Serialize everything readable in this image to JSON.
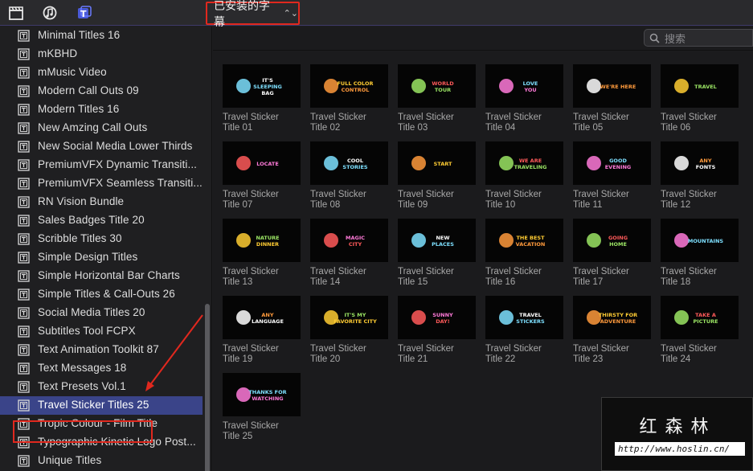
{
  "toolbar": {
    "library_title": "已安装的字幕"
  },
  "sidebar": {
    "items": [
      {
        "label": "Minimal Titles 16"
      },
      {
        "label": "mKBHD"
      },
      {
        "label": "mMusic Video"
      },
      {
        "label": "Modern Call Outs 09"
      },
      {
        "label": "Modern Titles 16"
      },
      {
        "label": "New Amzing Call Outs"
      },
      {
        "label": "New Social Media Lower Thirds"
      },
      {
        "label": "PremiumVFX Dynamic Transiti..."
      },
      {
        "label": "PremiumVFX Seamless Transiti..."
      },
      {
        "label": "RN Vision Bundle"
      },
      {
        "label": "Sales Badges Title 20"
      },
      {
        "label": "Scribble Titles 30"
      },
      {
        "label": "Simple Design Titles"
      },
      {
        "label": "Simple Horizontal Bar Charts"
      },
      {
        "label": "Simple Titles & Call-Outs 26"
      },
      {
        "label": "Social Media Titles 20"
      },
      {
        "label": "Subtitles Tool FCPX"
      },
      {
        "label": "Text Animation Toolkit 87"
      },
      {
        "label": "Text Messages 18"
      },
      {
        "label": "Text Presets Vol.1"
      },
      {
        "label": "Travel Sticker Titles 25",
        "selected": true
      },
      {
        "label": "Tropic Colour - Film Title"
      },
      {
        "label": "Typographic Kinetic Logo Post..."
      },
      {
        "label": "Unique Titles"
      }
    ]
  },
  "search": {
    "placeholder": "搜索"
  },
  "tiles": [
    {
      "line1": "Travel Sticker",
      "line2": "Title 01",
      "art": [
        "IT'S",
        "SLEEPING",
        "BAG"
      ]
    },
    {
      "line1": "Travel Sticker",
      "line2": "Title 02",
      "art": [
        "FULL COLOR",
        "CONTROL"
      ]
    },
    {
      "line1": "Travel Sticker",
      "line2": "Title 03",
      "art": [
        "WORLD",
        "TOUR"
      ]
    },
    {
      "line1": "Travel Sticker",
      "line2": "Title 04",
      "art": [
        "LOVE",
        "YOU"
      ]
    },
    {
      "line1": "Travel Sticker",
      "line2": "Title 05",
      "art": [
        "WE'RE HERE"
      ]
    },
    {
      "line1": "Travel Sticker",
      "line2": "Title 06",
      "art": [
        "TRAVEL"
      ]
    },
    {
      "line1": "Travel Sticker",
      "line2": "Title 07",
      "art": [
        "LOCATE"
      ]
    },
    {
      "line1": "Travel Sticker",
      "line2": "Title 08",
      "art": [
        "COOL",
        "STORIES"
      ]
    },
    {
      "line1": "Travel Sticker",
      "line2": "Title 09",
      "art": [
        "START"
      ]
    },
    {
      "line1": "Travel Sticker",
      "line2": "Title 10",
      "art": [
        "WE ARE",
        "TRAVELING"
      ]
    },
    {
      "line1": "Travel Sticker",
      "line2": "Title 11",
      "art": [
        "GOOD",
        "EVENING"
      ]
    },
    {
      "line1": "Travel Sticker",
      "line2": "Title 12",
      "art": [
        "ANY",
        "FONTS"
      ]
    },
    {
      "line1": "Travel Sticker",
      "line2": "Title 13",
      "art": [
        "NATURE",
        "DINNER"
      ]
    },
    {
      "line1": "Travel Sticker",
      "line2": "Title 14",
      "art": [
        "MAGIC",
        "CITY"
      ]
    },
    {
      "line1": "Travel Sticker",
      "line2": "Title 15",
      "art": [
        "NEW",
        "PLACES"
      ]
    },
    {
      "line1": "Travel Sticker",
      "line2": "Title 16",
      "art": [
        "THE BEST",
        "VACATION"
      ]
    },
    {
      "line1": "Travel Sticker",
      "line2": "Title 17",
      "art": [
        "GOING",
        "HOME"
      ]
    },
    {
      "line1": "Travel Sticker",
      "line2": "Title 18",
      "art": [
        "MOUNTAINS"
      ]
    },
    {
      "line1": "Travel Sticker",
      "line2": "Title 19",
      "art": [
        "ANY",
        "LANGUAGE"
      ]
    },
    {
      "line1": "Travel Sticker",
      "line2": "Title 20",
      "art": [
        "IT'S MY",
        "FAVORITE CITY"
      ]
    },
    {
      "line1": "Travel Sticker",
      "line2": "Title 21",
      "art": [
        "SUNNY",
        "DAY!"
      ]
    },
    {
      "line1": "Travel Sticker",
      "line2": "Title 22",
      "art": [
        "TRAVEL",
        "STICKERS"
      ]
    },
    {
      "line1": "Travel Sticker",
      "line2": "Title 23",
      "art": [
        "THIRSTY FOR",
        "ADVENTURE"
      ]
    },
    {
      "line1": "Travel Sticker",
      "line2": "Title 24",
      "art": [
        "TAKE A",
        "PICTURE"
      ]
    },
    {
      "line1": "Travel Sticker",
      "line2": "Title 25",
      "art": [
        "THANKS FOR",
        "WATCHING"
      ]
    }
  ],
  "watermark": {
    "title": "红森林",
    "url": "http://www.hoslin.cn/"
  },
  "colors": {
    "accent_selection": "#3a4489",
    "annotation_red": "#e0281e"
  }
}
